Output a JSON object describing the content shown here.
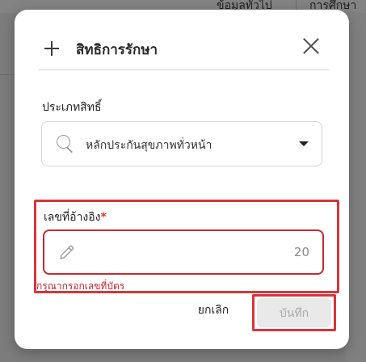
{
  "background": {
    "tabs": [
      "ข้อมูลทั่วไป",
      "การศึกษา"
    ]
  },
  "dialog": {
    "title": "สิทธิการรักษา",
    "icons": {
      "header": "plus-icon",
      "close": "close-icon"
    },
    "type_field": {
      "label": "ประเภทสิทธิ์",
      "value": "หลักประกันสุขภาพทั่วหน้า",
      "icon": "search-icon",
      "caret": "caret-down-icon"
    },
    "ref_field": {
      "label": "เลขที่อ้างอิง",
      "required_marker": "*",
      "value": "",
      "icon": "pencil-icon",
      "char_count": "20",
      "error": "กรุณากรอกเลขที่บัตร"
    },
    "buttons": {
      "cancel": "ยกเลิก",
      "save": "บันทึก"
    },
    "colors": {
      "error": "#d9343a",
      "disabled_bg": "#e9e9e9",
      "disabled_text": "#a9a9a9"
    }
  }
}
